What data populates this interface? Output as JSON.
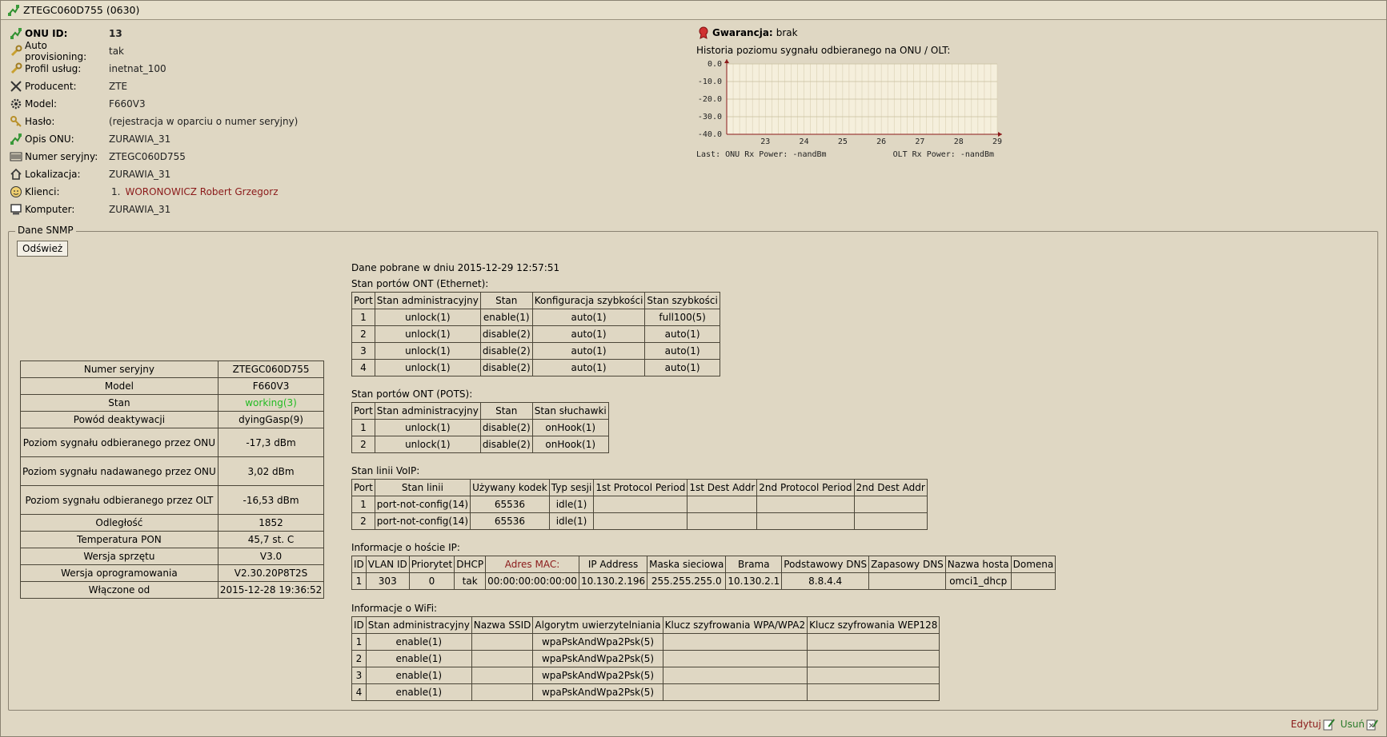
{
  "window": {
    "title": "ZTEGC060D755 (0630)"
  },
  "info": {
    "onu_id": {
      "label": "ONU ID:",
      "value": "13"
    },
    "auto_prov": {
      "label": "Auto provisioning:",
      "value": "tak"
    },
    "profile": {
      "label": "Profil usług:",
      "value": "inetnat_100"
    },
    "producer": {
      "label": "Producent:",
      "value": "ZTE"
    },
    "model": {
      "label": "Model:",
      "value": "F660V3"
    },
    "password": {
      "label": "Hasło:",
      "value": "(rejestracja w oparciu o numer seryjny)"
    },
    "desc": {
      "label": "Opis ONU:",
      "value": "ZURAWIA_31"
    },
    "serial": {
      "label": "Numer seryjny:",
      "value": "ZTEGC060D755"
    },
    "location": {
      "label": "Lokalizacja:",
      "value": "ZURAWIA_31"
    },
    "clients": {
      "label": "Klienci:",
      "index": "1.",
      "value": "WORONOWICZ Robert Grzegorz"
    },
    "computer": {
      "label": "Komputer:",
      "value": "ZURAWIA_31"
    }
  },
  "warranty": {
    "label": "Gwarancja:",
    "value": "brak"
  },
  "history_title": "Historia poziomu sygnału odbieranego na ONU / OLT:",
  "chart_data": {
    "type": "line",
    "x_ticks": [
      "23",
      "24",
      "25",
      "26",
      "27",
      "28",
      "29"
    ],
    "y_ticks": [
      "0.0",
      "-10.0",
      "-20.0",
      "-30.0",
      "-40.0"
    ],
    "ylim": [
      -40,
      0
    ],
    "xlim": [
      22,
      29
    ],
    "grid": true,
    "series": [],
    "footer_left": "Last: ONU Rx Power: -nandBm",
    "footer_right": "OLT Rx Power: -nandBm",
    "colors": {
      "background": "#f5efdc",
      "grid": "#d9cfb2",
      "axis": "#8b1a1a"
    }
  },
  "snmp": {
    "legend": "Dane SNMP",
    "refresh": "Odśwież",
    "fetched": "Dane pobrane w dniu 2015-12-29 12:57:51"
  },
  "summary": [
    [
      "Numer seryjny",
      "ZTEGC060D755"
    ],
    [
      "Model",
      "F660V3"
    ],
    [
      "Stan",
      "working(3)"
    ],
    [
      "Powód deaktywacji",
      "dyingGasp(9)"
    ],
    [
      "Poziom sygnału odbieranego przez ONU",
      "-17,3 dBm"
    ],
    [
      "Poziom sygnału nadawanego przez ONU",
      "3,02 dBm"
    ],
    [
      "Poziom sygnału odbieranego przez OLT",
      "-16,53 dBm"
    ],
    [
      "Odległość",
      "1852"
    ],
    [
      "Temperatura PON",
      "45,7 st. C"
    ],
    [
      "Wersja sprzętu",
      "V3.0"
    ],
    [
      "Wersja oprogramowania",
      "V2.30.20P8T2S"
    ],
    [
      "Włączone od",
      "2015-12-28 19:36:52"
    ]
  ],
  "ethernet": {
    "title": "Stan portów ONT (Ethernet):",
    "headers": [
      "Port",
      "Stan administracyjny",
      "Stan",
      "Konfiguracja szybkości",
      "Stan szybkości"
    ],
    "rows": [
      [
        "1",
        "unlock(1)",
        "enable(1)",
        "auto(1)",
        "full100(5)"
      ],
      [
        "2",
        "unlock(1)",
        "disable(2)",
        "auto(1)",
        "auto(1)"
      ],
      [
        "3",
        "unlock(1)",
        "disable(2)",
        "auto(1)",
        "auto(1)"
      ],
      [
        "4",
        "unlock(1)",
        "disable(2)",
        "auto(1)",
        "auto(1)"
      ]
    ]
  },
  "pots": {
    "title": "Stan portów ONT (POTS):",
    "headers": [
      "Port",
      "Stan administracyjny",
      "Stan",
      "Stan słuchawki"
    ],
    "rows": [
      [
        "1",
        "unlock(1)",
        "disable(2)",
        "onHook(1)"
      ],
      [
        "2",
        "unlock(1)",
        "disable(2)",
        "onHook(1)"
      ]
    ]
  },
  "voip": {
    "title": "Stan linii VoIP:",
    "headers": [
      "Port",
      "Stan linii",
      "Używany kodek",
      "Typ sesji",
      "1st Protocol Period",
      "1st Dest Addr",
      "2nd Protocol Period",
      "2nd Dest Addr"
    ],
    "rows": [
      [
        "1",
        "port-not-config(14)",
        "65536",
        "idle(1)",
        "",
        "",
        "",
        ""
      ],
      [
        "2",
        "port-not-config(14)",
        "65536",
        "idle(1)",
        "",
        "",
        "",
        ""
      ]
    ]
  },
  "ip": {
    "title": "Informacje o hoście IP:",
    "headers": [
      "ID",
      "VLAN ID",
      "Priorytet",
      "DHCP",
      "Adres MAC:",
      "IP Address",
      "Maska sieciowa",
      "Brama",
      "Podstawowy DNS",
      "Zapasowy DNS",
      "Nazwa hosta",
      "Domena"
    ],
    "rows": [
      [
        "1",
        "303",
        "0",
        "tak",
        "00:00:00:00:00:00",
        "10.130.2.196",
        "255.255.255.0",
        "10.130.2.1",
        "8.8.4.4",
        "",
        "omci1_dhcp",
        ""
      ]
    ]
  },
  "wifi": {
    "title": "Informacje o WiFi:",
    "headers": [
      "ID",
      "Stan administracyjny",
      "Nazwa SSID",
      "Algorytm uwierzytelniania",
      "Klucz szyfrowania WPA/WPA2",
      "Klucz szyfrowania WEP128"
    ],
    "rows": [
      [
        "1",
        "enable(1)",
        "",
        "wpaPskAndWpa2Psk(5)",
        "",
        ""
      ],
      [
        "2",
        "enable(1)",
        "",
        "wpaPskAndWpa2Psk(5)",
        "",
        ""
      ],
      [
        "3",
        "enable(1)",
        "",
        "wpaPskAndWpa2Psk(5)",
        "",
        ""
      ],
      [
        "4",
        "enable(1)",
        "",
        "wpaPskAndWpa2Psk(5)",
        "",
        ""
      ]
    ]
  },
  "footer": {
    "edit": "Edytuj",
    "delete": "Usuń"
  }
}
